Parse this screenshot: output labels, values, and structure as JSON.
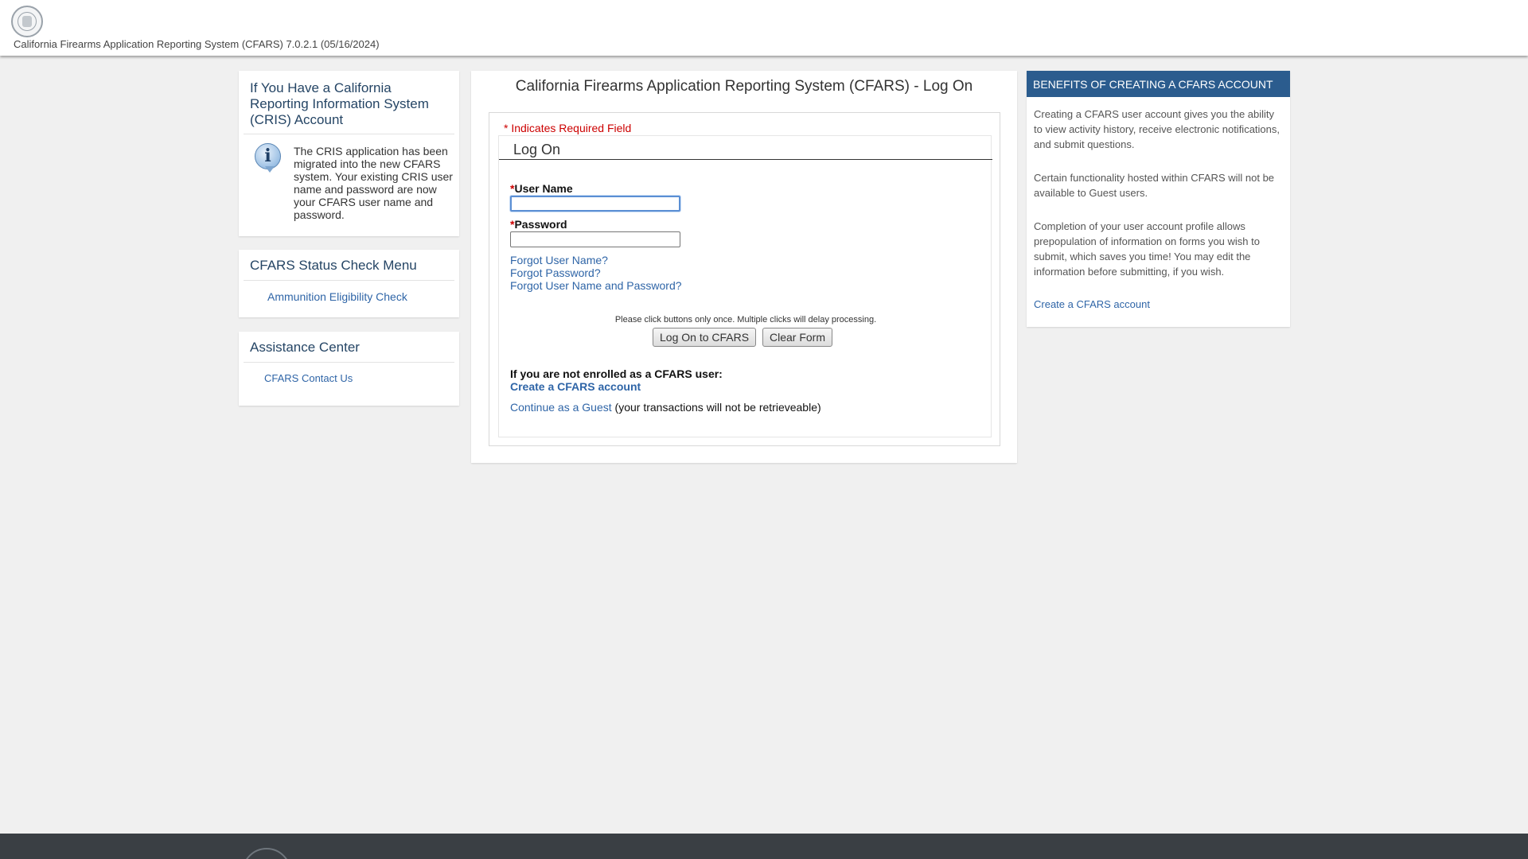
{
  "header": {
    "system_version": "California Firearms Application Reporting System (CFARS) 7.0.2.1 (05/16/2024)",
    "seal_icon": "state-seal-icon"
  },
  "cris_panel": {
    "title": "If You Have a California Reporting Information System (CRIS) Account",
    "icon": "info-icon",
    "icon_glyph": "i",
    "body": "The CRIS application has been migrated into the new CFARS system. Your existing CRIS user name and password are now your CFARS user name and password."
  },
  "status_panel": {
    "title": "CFARS Status Check Menu",
    "links": [
      "Ammunition Eligibility Check"
    ]
  },
  "assist_panel": {
    "title": "Assistance Center",
    "links": [
      "CFARS Contact Us"
    ]
  },
  "logon": {
    "page_title": "California Firearms Application Reporting System (CFARS) - Log On",
    "required_note": "* Indicates Required Field",
    "legend": "Log On",
    "required_marker": "*",
    "username_label": "User Name",
    "username_value": "",
    "password_label": "Password",
    "password_value": "",
    "forgot_username": "Forgot User Name?",
    "forgot_password": "Forgot Password?",
    "forgot_both": "Forgot User Name and Password?",
    "click_note": "Please click buttons only once. Multiple clicks will delay processing.",
    "logon_button": "Log On to CFARS",
    "clear_button": "Clear Form",
    "not_enrolled": "If you are not enrolled as a CFARS user:",
    "create_account": "Create a CFARS account",
    "continue_guest": "Continue as a Guest",
    "guest_note": " (your transactions will not be retrieveable)"
  },
  "benefits": {
    "header": "BENEFITS OF CREATING A CFARS ACCOUNT",
    "paragraphs": [
      "Creating a CFARS user account gives you the ability to view activity history, receive electronic notifications, and submit questions.",
      "Certain functionality hosted within CFARS will not be available to Guest users.",
      "Completion of your user account profile allows prepopulation of information on forms you wish to submit, which saves you time! You may edit the information before submitting, if you wish."
    ],
    "create_link": "Create a CFARS account"
  },
  "colors": {
    "link": "#2f65a7",
    "benefits_header": "#2b5c8e",
    "required": "#cc0000",
    "footer": "#3a3f44",
    "background": "#f0f0f0"
  }
}
